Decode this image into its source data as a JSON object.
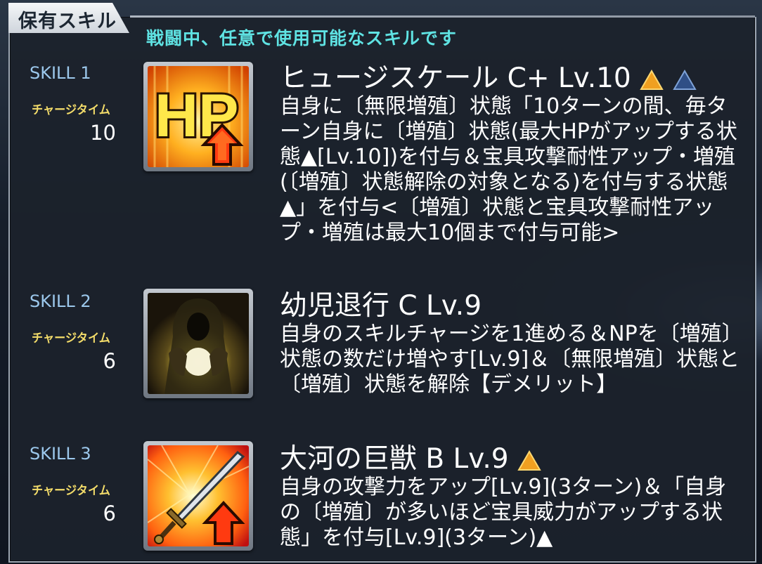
{
  "header": {
    "tab_label": "保有スキル",
    "subtitle": "戦闘中、任意で使用可能なスキルです"
  },
  "skills": [
    {
      "slot": "SKILL 1",
      "charge_label": "チャージタイム",
      "charge_value": "10",
      "icon": "hp-up-icon",
      "name": "ヒュージスケール C+ Lv.10",
      "desc": "自身に〔無限増殖〕状態「10ターンの間、毎ターン自身に〔増殖〕状態(最大HPがアップする状態▲[Lv.10])を付与＆宝具攻撃耐性アップ・増殖(〔増殖〕状態解除の対象となる)を付与する状態▲」を付与<〔増殖〕状態と宝具攻撃耐性アップ・増殖は最大10個まで付与可能>"
    },
    {
      "slot": "SKILL 2",
      "charge_label": "チャージタイム",
      "charge_value": "6",
      "icon": "hooded-figure-orb-icon",
      "name": "幼児退行 C Lv.9",
      "desc": "自身のスキルチャージを1進める＆NPを〔増殖〕状態の数だけ増やす[Lv.9]＆〔無限増殖〕状態と〔増殖〕状態を解除【デメリット】"
    },
    {
      "slot": "SKILL 3",
      "charge_label": "チャージタイム",
      "charge_value": "6",
      "icon": "sword-attack-up-icon",
      "name": "大河の巨獣 B Lv.9",
      "desc": "自身の攻撃力をアップ[Lv.9](3ターン)＆「自身の〔増殖〕が多いほど宝具威力がアップする状態」を付与[Lv.9](3ターン)▲"
    }
  ],
  "colors": {
    "subtitle": "#5fe3e3",
    "skill_slot": "#9cc8ec",
    "charge_label": "#f3dc6a",
    "upgrade_triangle": "#f0a020",
    "rank_up_triangle": "#2f4f86"
  }
}
